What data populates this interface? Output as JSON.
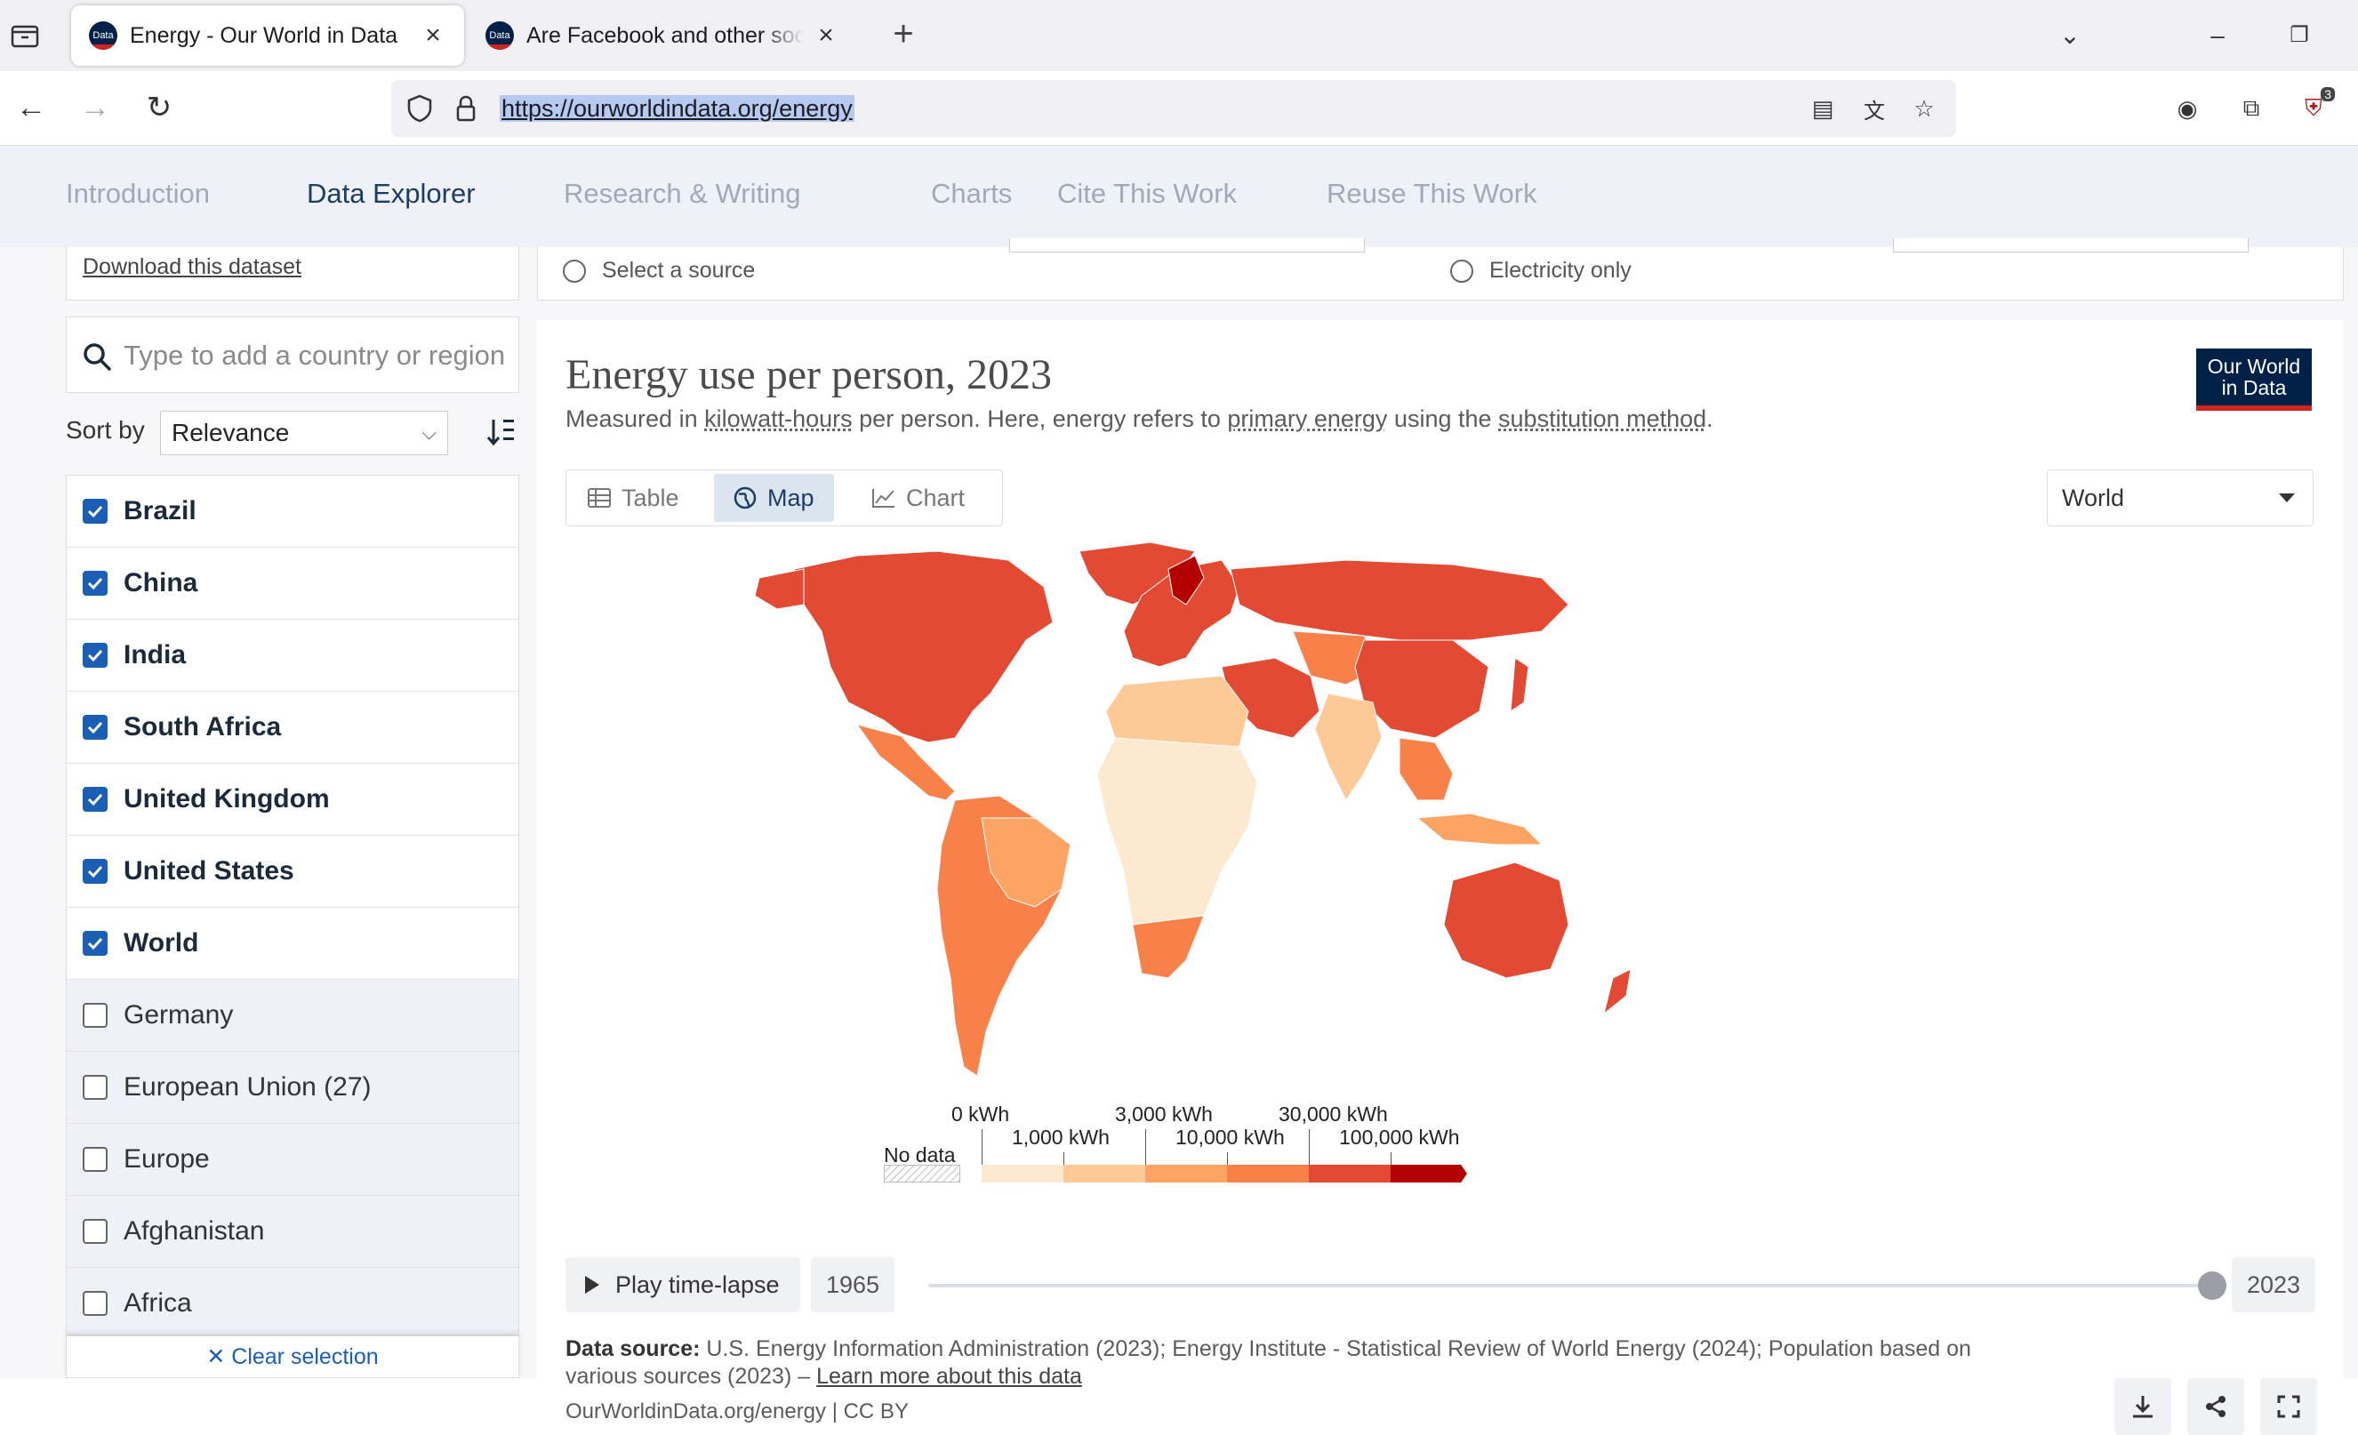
{
  "browser": {
    "tabs": [
      {
        "title": "Energy - Our World in Data",
        "favicon": "Data"
      },
      {
        "title": "Are Facebook and other social media",
        "favicon": "Data"
      }
    ],
    "url": "https://ourworldindata.org/energy",
    "extension_badge": "3"
  },
  "owid_nav": {
    "items": [
      "Introduction",
      "Data Explorer",
      "Research & Writing",
      "Charts",
      "Cite This Work",
      "Reuse This Work"
    ],
    "active": "Data Explorer"
  },
  "sidebar": {
    "download_link": "Download this dataset",
    "search_placeholder": "Type to add a country or region...",
    "sort_label": "Sort by",
    "sort_value": "Relevance",
    "entities": [
      {
        "name": "Brazil",
        "checked": true
      },
      {
        "name": "China",
        "checked": true
      },
      {
        "name": "India",
        "checked": true
      },
      {
        "name": "South Africa",
        "checked": true
      },
      {
        "name": "United Kingdom",
        "checked": true
      },
      {
        "name": "United States",
        "checked": true
      },
      {
        "name": "World",
        "checked": true
      },
      {
        "name": "Germany",
        "checked": false
      },
      {
        "name": "European Union (27)",
        "checked": false
      },
      {
        "name": "Europe",
        "checked": false
      },
      {
        "name": "Afghanistan",
        "checked": false
      },
      {
        "name": "Africa",
        "checked": false
      }
    ],
    "clear_selection": "Clear selection"
  },
  "controls": {
    "radio_source": "Select a source",
    "radio_electricity": "Electricity only"
  },
  "chart": {
    "title": "Energy use per person, 2023",
    "subtitle_parts": {
      "p1": "Measured in ",
      "u1": "kilowatt-hours",
      "p2": " per person. Here, energy refers to ",
      "u2": "primary energy",
      "p3": " using the ",
      "u3": "substitution method",
      "p4": "."
    },
    "logo_line1": "Our World",
    "logo_line2": "in Data",
    "view_tabs": [
      "Table",
      "Map",
      "Chart"
    ],
    "active_view": "Map",
    "region": "World",
    "legend": {
      "no_data": "No data",
      "labels_top": [
        "0 kWh",
        "3,000 kWh",
        "30,000 kWh"
      ],
      "labels_bottom": [
        "1,000 kWh",
        "10,000 kWh",
        "100,000 kWh"
      ],
      "colors": [
        "#fde9d0",
        "#fdc996",
        "#fca464",
        "#f8814a",
        "#e34a33",
        "#b30000"
      ]
    },
    "timeline": {
      "play_label": "Play time-lapse",
      "start_year": "1965",
      "end_year": "2023",
      "position": 1.0
    },
    "source_label": "Data source:",
    "source_text": "U.S. Energy Information Administration (2023); Energy Institute - Statistical Review of World Energy (2024); Population based on various sources (2023) – ",
    "source_link": "Learn more about this data",
    "credit": "OurWorldinData.org/energy | CC BY"
  }
}
